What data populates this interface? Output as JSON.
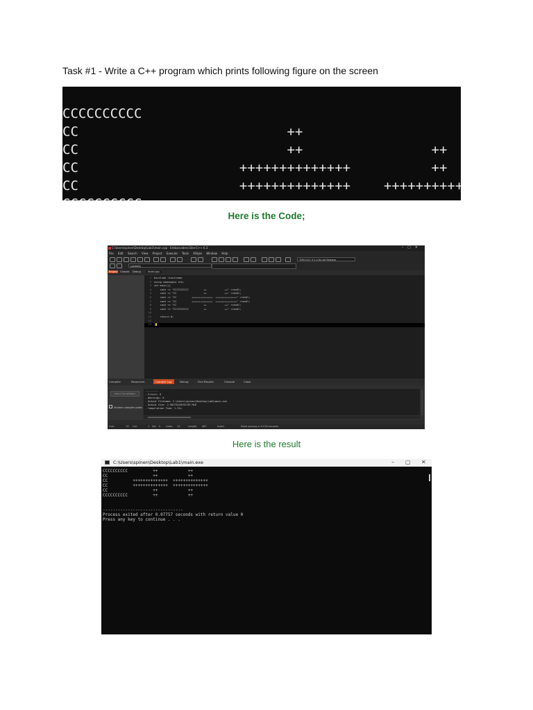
{
  "task": {
    "title": "Task #1 - Write a C++ program which prints following figure on the screen"
  },
  "figure": {
    "rows": [
      [
        "CCCCCCCCCC",
        "++",
        "++"
      ],
      [
        "CC",
        "++",
        "++"
      ],
      [
        "CC",
        "++++++++++++++",
        "++++++++++++++"
      ],
      [
        "CC",
        "++++++++++++++",
        "++++++++++++++"
      ],
      [
        "CC",
        "++",
        "++"
      ],
      [
        "CCCCCCCCCC",
        "++",
        "++"
      ]
    ]
  },
  "captions": {
    "code": "Here is the Code;",
    "result": "Here is the result"
  },
  "ide": {
    "title": "C:\\Users\\spinen\\Desktop\\Lab1\\main.cpp - Embarcadero Dev-C++ 6.3",
    "menu": [
      "File",
      "Edit",
      "Search",
      "View",
      "Project",
      "Execute",
      "Tools",
      "AStyle",
      "Window",
      "Help"
    ],
    "compiler": "TDM-GCC 9.2.0 64-bit Release",
    "scope": "(globals)",
    "left_tabs": [
      "Project",
      "Classes",
      "Debug"
    ],
    "file_tab": "main.cpp",
    "code_lines": [
      "#include <iostream>",
      "using namespace std;",
      "int main(){",
      "    cout << \"CCCCCCCCCC          ++            ++\" <<endl;",
      "    cout << \"CC                  ++            ++\" <<endl;",
      "    cout << \"CC          ++++++++++++++  ++++++++++++++\" <<endl;",
      "    cout << \"CC          ++++++++++++++  ++++++++++++++\" <<endl;",
      "    cout << \"CC                  ++            ++\" <<endl;",
      "    cout << \"CCCCCCCCCC          ++            ++\" <<endl;",
      "",
      "    return 0;",
      "",
      "}"
    ],
    "bottom_tabs": [
      "Compiler",
      "Resources",
      "Compile Log",
      "Debug",
      "Find Results",
      "Console",
      "Close"
    ],
    "abort_label": "Abort Compilation",
    "shorten_label": "Shorten compiler paths",
    "log_lines": [
      "---------",
      "- Errors: 0",
      "- Warnings: 0",
      "- Output Filename: C:\\Users\\spinen\\Desktop\\Lab1\\main.exe",
      "- Output Size: 2.90273428192139 MiB",
      "- Compilation Time: 1.31s"
    ],
    "status": [
      "Line:",
      "13",
      "Col:",
      "1",
      "Sel:",
      "0",
      "Lines:",
      "13",
      "Length:",
      "487",
      "Insert",
      "Done parsing in 0.016 seconds"
    ]
  },
  "console": {
    "title": "C:\\Users\\spinen\\Desktop\\Lab1\\main.exe",
    "lines": [
      "CCCCCCCCCC          ++            ++",
      "CC                  ++            ++",
      "CC          ++++++++++++++  ++++++++++++++",
      "CC          ++++++++++++++  ++++++++++++++",
      "CC                  ++            ++",
      "CCCCCCCCCC          ++            ++",
      "",
      "--------------------------------",
      "Process exited after 0.07757 seconds with return value 0",
      "Press any key to continue . . ."
    ]
  }
}
